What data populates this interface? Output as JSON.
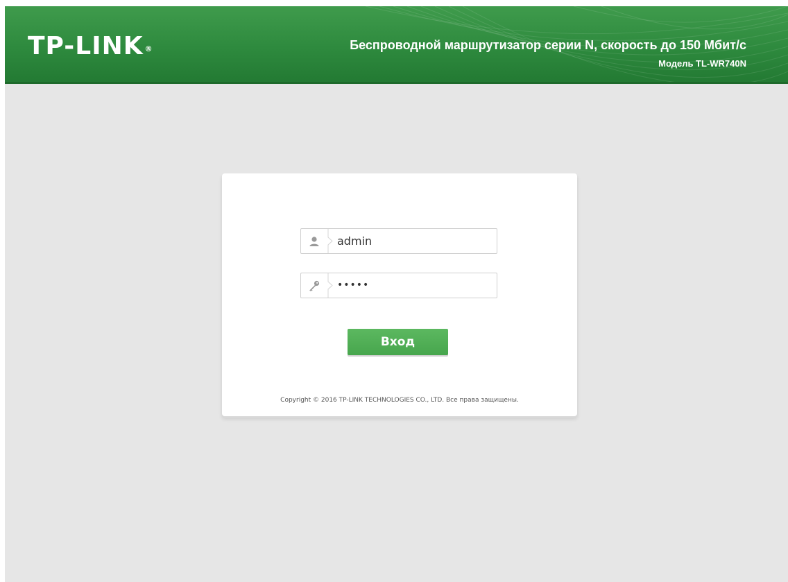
{
  "header": {
    "logo_text": "TP-LINK",
    "logo_reg": "®",
    "title": "Беспроводной маршрутизатор серии N, скорость до 150 Мбит/с",
    "model": "Модель TL-WR740N",
    "colors": {
      "header_green": "#2e8a3e",
      "button_green": "#4fae55",
      "page_bg": "#e6e6e6"
    }
  },
  "login": {
    "username_value": "admin",
    "username_icon": "user-icon",
    "password_value": "•••••",
    "password_icon": "key-icon",
    "submit_label": "Вход"
  },
  "footer": {
    "copyright": "Copyright © 2016 TP-LINK TECHNOLOGIES CO., LTD. Все права защищены."
  }
}
